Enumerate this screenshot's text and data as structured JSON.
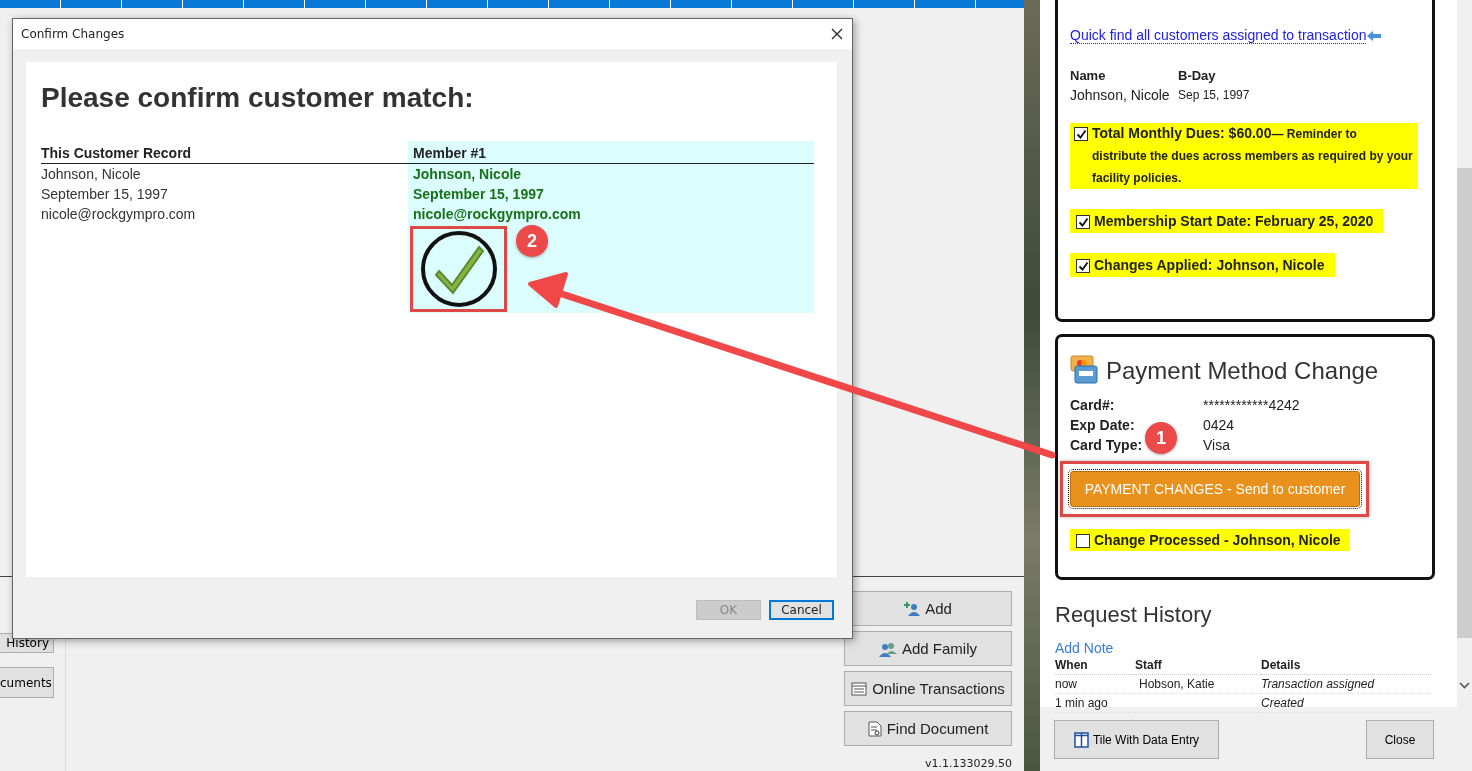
{
  "background_app": {
    "left_buttons": [
      {
        "label": "History"
      },
      {
        "label": "cuments"
      }
    ],
    "right_buttons": [
      {
        "label": "Add"
      },
      {
        "label": "Add Family"
      },
      {
        "label": "Online Transactions"
      },
      {
        "label": "Find Document"
      }
    ],
    "version": "v1.1.133029.50"
  },
  "dialog": {
    "title": "Confirm Changes",
    "heading": "Please confirm customer match:",
    "columns": [
      "This Customer Record",
      "Member #1"
    ],
    "customer_lines": [
      "Johnson, Nicole",
      "September 15, 1997",
      "nicole@rockgympro.com"
    ],
    "member_lines": [
      "Johnson, Nicole",
      "September 15, 1997",
      "nicole@rockgympro.com"
    ],
    "matched": true,
    "buttons": [
      {
        "label": "OK",
        "disabled": true
      },
      {
        "label": "Cancel",
        "disabled": false
      }
    ]
  },
  "request_card": {
    "quick_find_link": "Quick find all customers assigned to transaction",
    "people_columns": [
      "Name",
      "B-Day"
    ],
    "people_rows": [
      {
        "name": "Johnson, Nicole",
        "bday": "Sep 15, 1997"
      }
    ],
    "checks": [
      {
        "checked": true,
        "label": "Total Monthly Dues: $60.00",
        "note": "— Reminder to distribute the dues across members as required by your facility policies."
      },
      {
        "checked": true,
        "label": "Membership Start Date: February 25, 2020"
      },
      {
        "checked": true,
        "label": "Changes Applied: Johnson, Nicole"
      }
    ]
  },
  "payment_card": {
    "title": "Payment Method Change",
    "fields": [
      {
        "label": "Card#:",
        "value": "************4242"
      },
      {
        "label": "Exp Date:",
        "value": "0424"
      },
      {
        "label": "Card Type:",
        "value": "Visa"
      }
    ],
    "send_button": "PAYMENT CHANGES - Send to customer",
    "processed": {
      "checked": false,
      "label": "Change Processed - Johnson, Nicole"
    }
  },
  "history": {
    "title": "Request History",
    "add_note": "Add Note",
    "columns": [
      "When",
      "Staff",
      "Details"
    ],
    "rows": [
      {
        "when": "now",
        "staff": "Hobson, Katie",
        "details": "Transaction assigned"
      },
      {
        "when": "1 min ago",
        "details": "Created"
      }
    ]
  },
  "footer_buttons": [
    {
      "label": "Tile With Data Entry"
    },
    {
      "label": "Close"
    }
  ],
  "markers": [
    {
      "number": "1"
    },
    {
      "number": "2"
    }
  ]
}
